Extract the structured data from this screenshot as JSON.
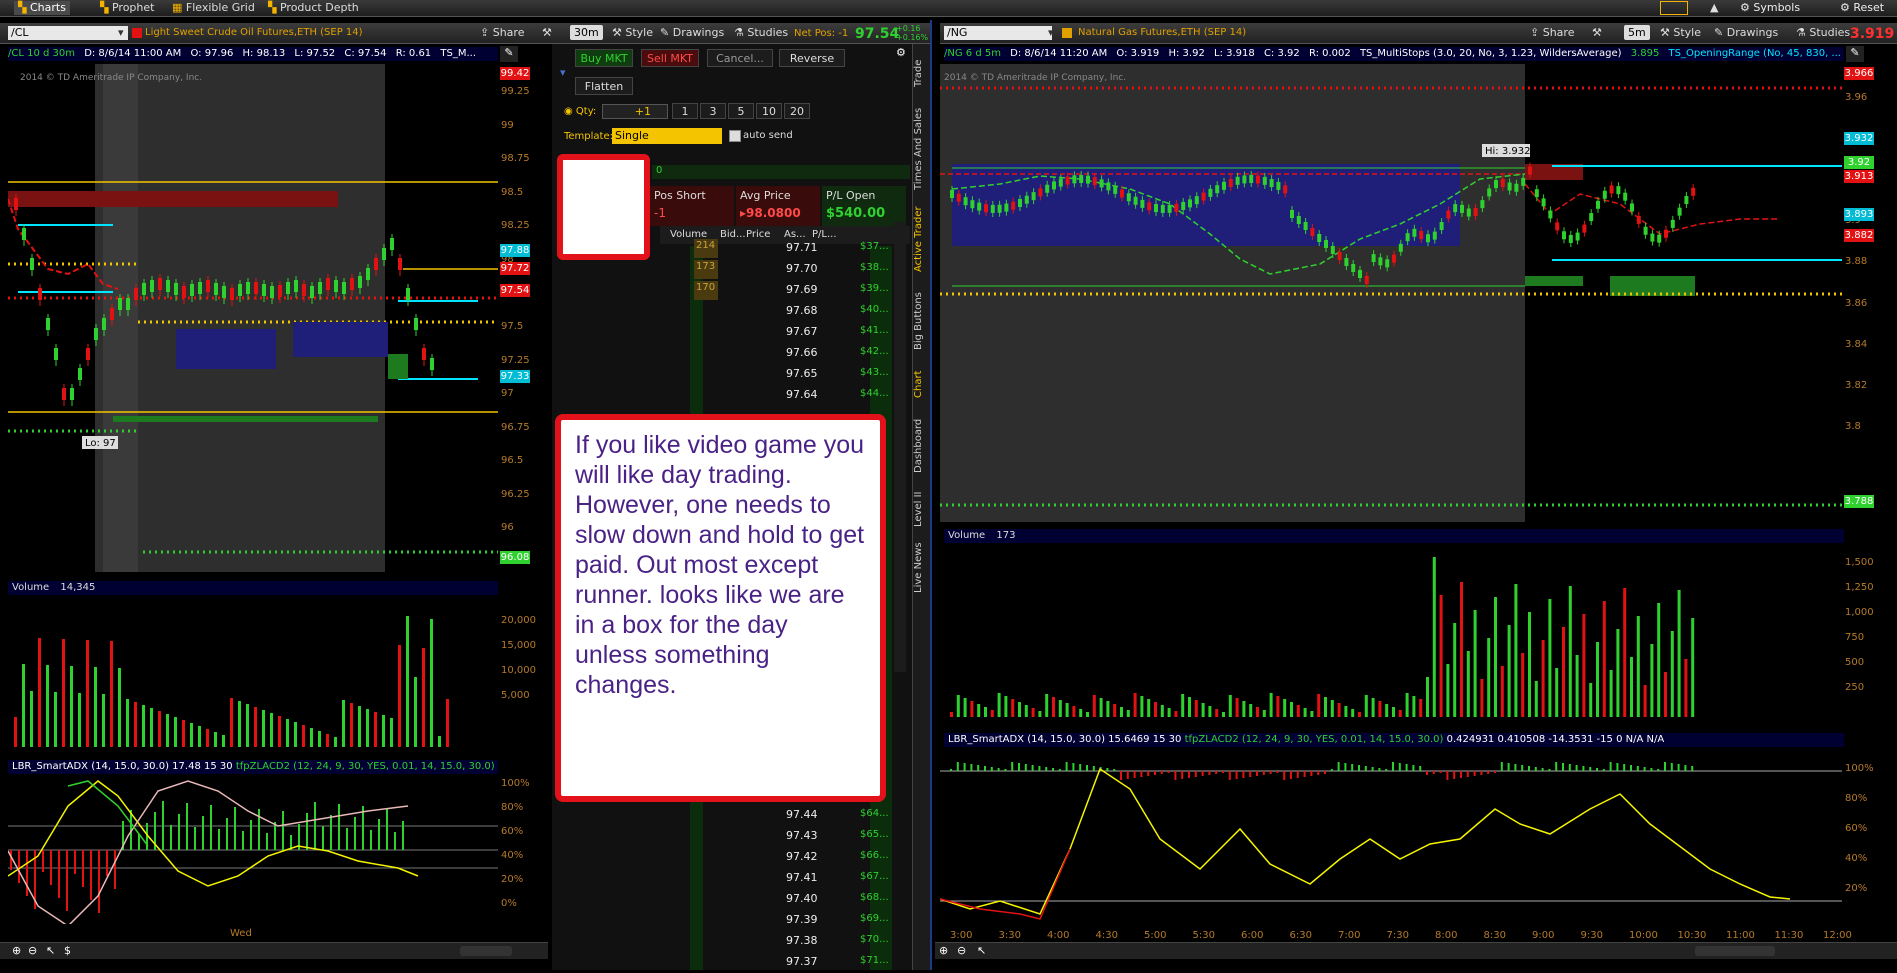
{
  "topbar": {
    "tabs": [
      "Charts",
      "Prophet",
      "Flexible Grid",
      "Product Depth"
    ],
    "right": [
      "Symbols",
      "Reset"
    ]
  },
  "left_chart": {
    "symbol": "/CL",
    "desc": "Light Sweet Crude Oil Futures,ETH (SEP 14)",
    "buttons": {
      "share": "Share",
      "period": "30m",
      "style": "Style",
      "drawings": "Drawings",
      "studies": "Studies"
    },
    "net_pos": "Net Pos: -1",
    "last": "97.54",
    "change": "+0.16",
    "change_pct": "+0.16%",
    "info": [
      "/CL 10 d 30m",
      "D: 8/6/14 11:00 AM",
      "O: 97.96",
      "H: 98.13",
      "L: 97.52",
      "C: 97.54",
      "R: 0.61",
      "TS_M..."
    ],
    "watermark": "2014 © TD Ameritrade IP Company, Inc.",
    "y_ticks": [
      "99.25",
      "99",
      "98.75",
      "98.5",
      "98.25",
      "98",
      "97.75",
      "97.5",
      "97.25",
      "97",
      "96.75",
      "96.5",
      "96.25",
      "96"
    ],
    "tags": [
      {
        "text": "99.42",
        "color": "#e31212"
      },
      {
        "text": "97.88",
        "color": "#00bcd4"
      },
      {
        "text": "97.72",
        "color": "#e31212"
      },
      {
        "text": "97.54",
        "color": "#e31212"
      },
      {
        "text": "97.33",
        "color": "#00bcd4"
      },
      {
        "text": "96.08",
        "color": "#2fd12f"
      }
    ],
    "lo_label": "Lo: 97",
    "volume_label": "Volume",
    "volume_value": "14,345",
    "vol_ticks": [
      "20,000",
      "15,000",
      "10,000",
      "5,000"
    ],
    "study": [
      "LBR_SmartADX (14, 15.0, 30.0)",
      "17.48",
      "15",
      "30",
      "tfpZLACD2 (12, 24, 9, 30, YES, 0.01, 14, 15.0, 30.0)"
    ],
    "study_ticks": [
      "100%",
      "80%",
      "60%",
      "40%",
      "20%",
      "0%"
    ],
    "time_label": "Wed"
  },
  "trader": {
    "buy": "Buy MKT",
    "sell": "Sell MKT",
    "cancel": "Cancel...",
    "reverse": "Reverse",
    "flatten": "Flatten",
    "qty_label": "Qty:",
    "qty_value": "+1",
    "qty_presets": [
      "1",
      "3",
      "5",
      "10",
      "20"
    ],
    "template_label": "Template:",
    "template_value": "Single",
    "auto_send": "auto send",
    "pos_label": "Pos Short",
    "pos_value": "-1",
    "avg_label": "Avg Price",
    "avg_value": "98.0800",
    "pl_label": "P/L Open",
    "pl_value": "$540.00",
    "top_zero": "0",
    "col_heads": [
      "Volume",
      "Bid...",
      "Price",
      "As...",
      "P/L..."
    ],
    "ladder_top": [
      {
        "vol": "214",
        "price": "97.71",
        "pl": "$37..."
      },
      {
        "vol": "173",
        "price": "97.70",
        "pl": "$38..."
      },
      {
        "vol": "170",
        "price": "97.69",
        "pl": "$39..."
      },
      {
        "vol": "",
        "price": "97.68",
        "pl": "$40..."
      },
      {
        "vol": "",
        "price": "97.67",
        "pl": "$41..."
      },
      {
        "vol": "",
        "price": "97.66",
        "pl": "$42..."
      },
      {
        "vol": "",
        "price": "97.65",
        "pl": "$43..."
      },
      {
        "vol": "",
        "price": "97.64",
        "pl": "$44..."
      }
    ],
    "ladder_bottom": [
      {
        "vol": "",
        "price": "97.44",
        "pl": "$64..."
      },
      {
        "vol": "",
        "price": "97.43",
        "pl": "$65..."
      },
      {
        "vol": "",
        "price": "97.42",
        "pl": "$66..."
      },
      {
        "vol": "",
        "price": "97.41",
        "pl": "$67..."
      },
      {
        "vol": "",
        "price": "97.40",
        "pl": "$68..."
      },
      {
        "vol": "",
        "price": "97.39",
        "pl": "$69..."
      },
      {
        "vol": "",
        "price": "97.38",
        "pl": "$70..."
      },
      {
        "vol": "",
        "price": "97.37",
        "pl": "$71..."
      }
    ],
    "side_tabs": [
      "Trade",
      "Times And Sales",
      "Active Trader",
      "Big Buttons",
      "Chart",
      "Dashboard",
      "Level II",
      "Live News"
    ]
  },
  "callout": {
    "text": "If you like video game you will like day trading. However, one needs to slow down and hold to get paid. Out most except runner. looks like we are in a box for the day unless something changes."
  },
  "right_chart": {
    "symbol": "/NG",
    "desc": "Natural Gas Futures,ETH (SEP 14)",
    "buttons": {
      "share": "Share",
      "period": "5m",
      "style": "Style",
      "drawings": "Drawings",
      "studies": "Studies"
    },
    "last": "3.919",
    "change": "+0.0",
    "info": [
      "/NG 6 d 5m",
      "D: 8/6/14 11:20 AM",
      "O: 3.919",
      "H: 3.92",
      "L: 3.918",
      "C: 3.92",
      "R: 0.002",
      "TS_MultiStops (3.0, 20, No, 3, 1.23, WildersAverage)",
      "3.895",
      "TS_OpeningRange (No, 45, 830, ..."
    ],
    "watermark": "2014 © TD Ameritrade IP Company, Inc.",
    "hi_label": "Hi: 3.932",
    "y_ticks": [
      "3.96",
      "3.94",
      "3.92",
      "3.9",
      "3.88",
      "3.86",
      "3.84",
      "3.82",
      "3.8"
    ],
    "tags": [
      {
        "text": "3.966",
        "color": "#e31212"
      },
      {
        "text": "3.932",
        "color": "#00bcd4"
      },
      {
        "text": "3.92",
        "color": "#2fd12f"
      },
      {
        "text": "3.913",
        "color": "#e31212"
      },
      {
        "text": "3.893",
        "color": "#00bcd4"
      },
      {
        "text": "3.882",
        "color": "#e31212"
      },
      {
        "text": "3.788",
        "color": "#2fd12f"
      }
    ],
    "volume_label": "Volume",
    "volume_value": "173",
    "vol_ticks": [
      "1,500",
      "1,250",
      "1,000",
      "750",
      "500",
      "250"
    ],
    "study": [
      "LBR_SmartADX (14, 15.0, 30.0)",
      "15.6469",
      "15",
      "30",
      "tfpZLACD2 (12, 24, 9, 30, YES, 0.01, 14, 15.0, 30.0)",
      "0.424931",
      "0.410508",
      "-14.3531",
      "-15",
      "0",
      "N/A",
      "N/A"
    ],
    "study_ticks": [
      "100%",
      "80%",
      "60%",
      "40%",
      "20%"
    ],
    "times": [
      "3:00",
      "3:30",
      "4:00",
      "4:30",
      "5:00",
      "5:30",
      "6:00",
      "6:30",
      "7:00",
      "7:30",
      "8:00",
      "8:30",
      "9:00",
      "9:30",
      "10:00",
      "10:30",
      "11:00",
      "11:30",
      "12:00"
    ]
  }
}
